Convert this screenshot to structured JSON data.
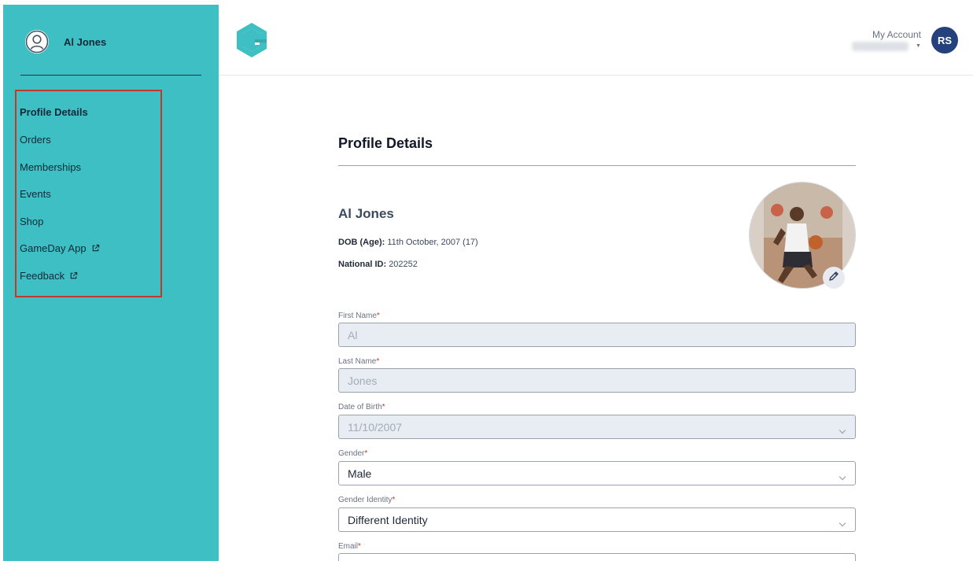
{
  "sidebar": {
    "user_name": "Al Jones",
    "items": [
      {
        "label": "Profile Details",
        "active": true,
        "external": false
      },
      {
        "label": "Orders",
        "active": false,
        "external": false
      },
      {
        "label": "Memberships",
        "active": false,
        "external": false
      },
      {
        "label": "Events",
        "active": false,
        "external": false
      },
      {
        "label": "Shop",
        "active": false,
        "external": false
      },
      {
        "label": "GameDay App",
        "active": false,
        "external": true
      },
      {
        "label": "Feedback",
        "active": false,
        "external": true
      }
    ]
  },
  "header": {
    "account_label": "My Account",
    "avatar_initials": "RS"
  },
  "main": {
    "title": "Profile Details",
    "name": "Al Jones",
    "dob_label": "DOB (Age):",
    "dob_value": "11th October, 2007 (17)",
    "national_id_label": "National ID:",
    "national_id_value": "202252",
    "fields": {
      "first_name": {
        "label": "First Name",
        "value": "Al"
      },
      "last_name": {
        "label": "Last Name",
        "value": "Jones"
      },
      "dob": {
        "label": "Date of Birth",
        "value": "11/10/2007"
      },
      "gender": {
        "label": "Gender",
        "value": "Male"
      },
      "gender_identity": {
        "label": "Gender Identity",
        "value": "Different Identity"
      },
      "email": {
        "label": "Email",
        "value": ""
      }
    },
    "required_marker": "*"
  },
  "colors": {
    "sidebar_bg": "#3ebfc4",
    "brand_teal": "#3ebfc4",
    "avatar_bg": "#24417e",
    "highlight_border": "#c0392b",
    "required": "#c0392b"
  },
  "icons": {
    "user": "user-circle-icon",
    "external": "external-link-icon",
    "edit": "pencil-icon",
    "chevron": "chevron-down-icon",
    "logo": "gameday-logo-icon"
  }
}
